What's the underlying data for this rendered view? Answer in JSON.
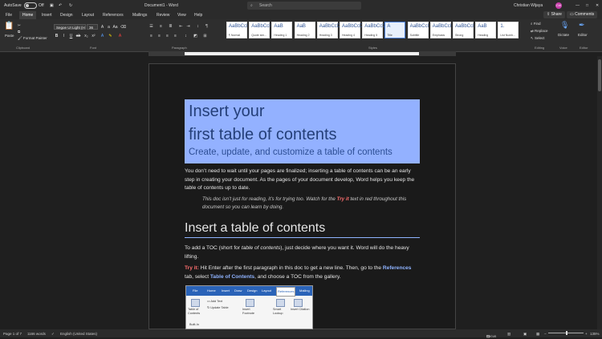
{
  "titlebar": {
    "autosave_label": "AutoSave",
    "autosave_state": "Off",
    "doc_title": "Document1  -  Word",
    "search_placeholder": "Search",
    "user_name": "Christian Wijaya",
    "user_initials": "CW"
  },
  "menu": {
    "tabs": [
      "File",
      "Home",
      "Insert",
      "Design",
      "Layout",
      "References",
      "Mailings",
      "Review",
      "View",
      "Help"
    ],
    "active": "Home",
    "share_label": "Share",
    "comments_label": "Comments"
  },
  "ribbon": {
    "clipboard": {
      "paste_label": "Paste",
      "cut_label": "Cut",
      "copy_label": "Copy",
      "format_painter_label": "Format Painter",
      "group_label": "Clipboard"
    },
    "font": {
      "font_name": "Segoe UI Light (H",
      "font_size": "36",
      "group_label": "Font"
    },
    "paragraph": {
      "group_label": "Paragraph"
    },
    "styles": {
      "group_label": "Styles",
      "items": [
        {
          "sample": "AaBbCcI",
          "name": "¶ Normal"
        },
        {
          "sample": "AaBbCcI",
          "name": "Quote sim..."
        },
        {
          "sample": "AaB",
          "name": "Heading 1"
        },
        {
          "sample": "AaB",
          "name": "Heading 2"
        },
        {
          "sample": "AaBbCcD",
          "name": "Heading 3"
        },
        {
          "sample": "AaBbCcD",
          "name": "Heading 4"
        },
        {
          "sample": "AaBbCcD",
          "name": "Heading 5"
        },
        {
          "sample": "A",
          "name": "Title"
        },
        {
          "sample": "AaBbCcI",
          "name": "Subtitle"
        },
        {
          "sample": "AaBbCcI",
          "name": "Emphasis"
        },
        {
          "sample": "AaBbCcI",
          "name": "Strong"
        },
        {
          "sample": "AaB",
          "name": "Heading"
        },
        {
          "sample": "1.",
          "name": "List Numb..."
        }
      ]
    },
    "editing": {
      "find_label": "Find",
      "replace_label": "Replace",
      "select_label": "Select",
      "group_label": "Editing"
    },
    "voice": {
      "dictate_label": "Dictate",
      "group_label": "Voice"
    },
    "editor": {
      "editor_label": "Editor",
      "group_label": "Editor"
    }
  },
  "document": {
    "title_line1": "Insert your",
    "title_line2": "first table of contents",
    "subtitle": "Create, update, and customize a table of contents",
    "para1": "You don’t need to wait until your pages are finalized; inserting a table of contents can be an early step in creating your document. As the pages of your document develop, Word helps you keep the table of contents up to date.",
    "quote_a": "This doc isn’t just for reading, it’s for trying too. Watch for the ",
    "quote_tryit": "Try it",
    "quote_b": " text in red throughout this document so you can learn by doing.",
    "heading": "Insert a table of contents",
    "para2_a": "To add a TOC (short for ",
    "para2_em": "table of contents",
    "para2_b": "), just decide where you want it. Word will do the heavy lifting.",
    "para3_tryit": "Try it:",
    "para3_a": " Hit Enter after the first paragraph in this doc to get a new line. Then, go to the ",
    "para3_ref": "References",
    "para3_b": " tab, select ",
    "para3_toc": "Table of Contents",
    "para3_c": ", and choose a TOC from the gallery.",
    "embedded": {
      "tabs": [
        "File",
        "Home",
        "Insert",
        "Draw",
        "Design",
        "Layout",
        "References",
        "Mailing"
      ],
      "active": "References",
      "items": {
        "toc": "Table of Contents",
        "add_text": "Add Text",
        "update_table": "Update Table",
        "insert_footnote": "Insert Footnote",
        "smart_lookup": "Smart Lookup",
        "insert_citation": "Insert Citation",
        "built_in": "Built-In"
      }
    }
  },
  "status": {
    "page": "Page 1 of 7",
    "words": "1166 words",
    "language": "English (United States)",
    "focus": "Focus",
    "zoom": "135%"
  }
}
